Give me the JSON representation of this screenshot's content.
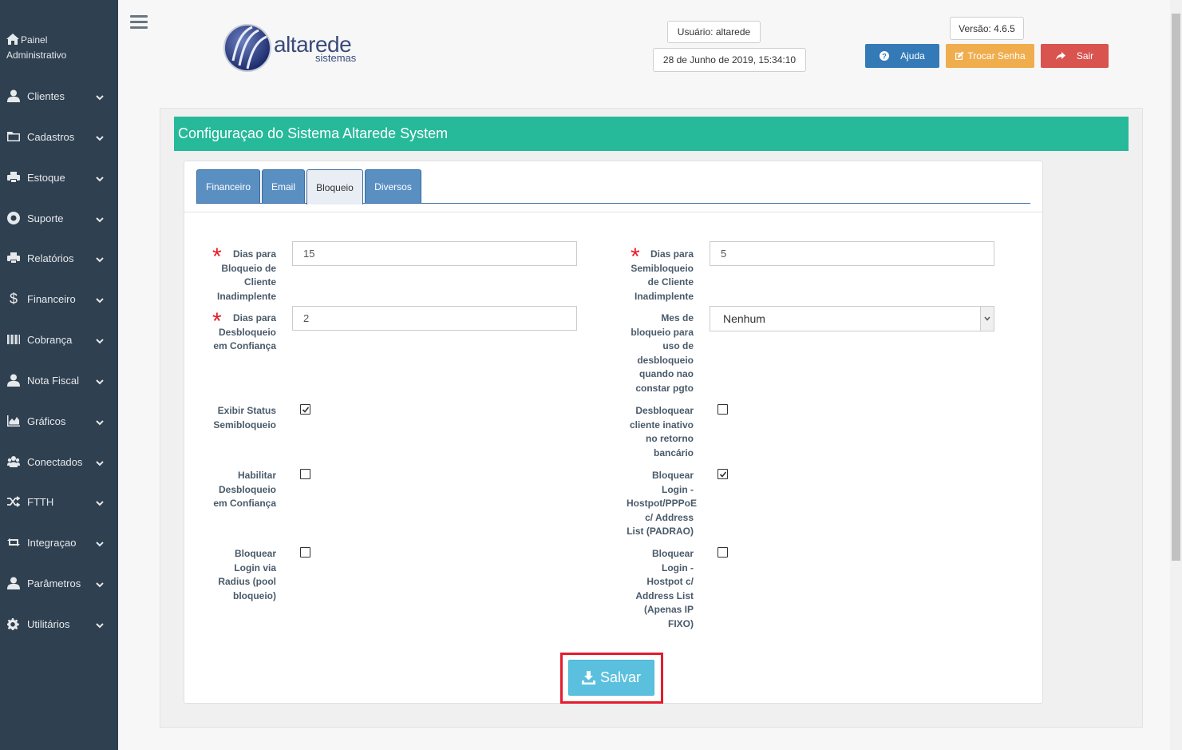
{
  "sidebar": {
    "panel_line1": "Painel",
    "panel_line2": "Administrativo",
    "items": [
      {
        "label": "Clientes",
        "icon": "user-icon"
      },
      {
        "label": "Cadastros",
        "icon": "folder-icon"
      },
      {
        "label": "Estoque",
        "icon": "printer-icon"
      },
      {
        "label": "Suporte",
        "icon": "lifebuoy-icon"
      },
      {
        "label": "Relatórios",
        "icon": "printer-icon"
      },
      {
        "label": "Financeiro",
        "icon": "dollar-icon"
      },
      {
        "label": "Cobrança",
        "icon": "barcode-icon"
      },
      {
        "label": "Nota Fiscal",
        "icon": "user-icon"
      },
      {
        "label": "Gráficos",
        "icon": "area-chart-icon"
      },
      {
        "label": "Conectados",
        "icon": "users-icon"
      },
      {
        "label": "FTTH",
        "icon": "shuffle-icon"
      },
      {
        "label": "Integraçao",
        "icon": "retweet-icon"
      },
      {
        "label": "Parâmetros",
        "icon": "user-icon"
      },
      {
        "label": "Utilitários",
        "icon": "cogs-icon"
      }
    ]
  },
  "header": {
    "logo_main": "altarede",
    "logo_sub": "sistemas",
    "user": "Usuário: altarede",
    "datetime": "28 de Junho de 2019, 15:34:10",
    "version": "Versão: 4.6.5",
    "help_label": "Ajuda",
    "change_password_label": "Trocar Senha",
    "exit_label": "Sair"
  },
  "page": {
    "title": "Configuraçao do Sistema Altarede System",
    "tabs": [
      "Financeiro",
      "Email",
      "Bloqueio",
      "Diversos"
    ],
    "active_tab": "Bloqueio"
  },
  "form": {
    "dias_bloqueio": {
      "label_lines": [
        "Dias para",
        "Bloqueio de",
        "Cliente",
        "Inadimplente"
      ],
      "value": "15"
    },
    "dias_semibloqueio": {
      "label_lines": [
        "Dias para",
        "Semibloqueio",
        "de Cliente",
        "Inadimplente"
      ],
      "value": "5"
    },
    "dias_desbloqueio": {
      "label_lines": [
        "Dias para",
        "Desbloqueio",
        "em Confiança"
      ],
      "value": "2"
    },
    "mes_bloqueio": {
      "label_lines": [
        "Mes de",
        "bloqueio para",
        "uso de",
        "desbloqueio",
        "quando nao",
        "constar pgto"
      ],
      "value": "Nenhum"
    },
    "exibir_status": {
      "label_lines": [
        "Exibir Status",
        "Semibloqueio"
      ],
      "checked": true
    },
    "desbloquear_inativo": {
      "label_lines": [
        "Desbloquear",
        "cliente inativo",
        "no retorno",
        "bancário"
      ],
      "checked": false
    },
    "habilitar_desbloqueio": {
      "label_lines": [
        "Habilitar",
        "Desbloqueio",
        "em Confiança"
      ],
      "checked": false
    },
    "bloquear_login_padrao": {
      "label_lines": [
        "Bloquear",
        "Login -",
        "Hostpot/PPPoE",
        "c/ Address",
        "List (PADRAO)"
      ],
      "checked": true
    },
    "bloquear_radius": {
      "label_lines": [
        "Bloquear",
        "Login via",
        "Radius (pool",
        "bloqueio)"
      ],
      "checked": false
    },
    "bloquear_login_ipfixo": {
      "label_lines": [
        "Bloquear",
        "Login -",
        "Hostpot c/",
        "Address List",
        "(Apenas IP",
        "FIXO)"
      ],
      "checked": false
    },
    "save_label": "Salvar"
  },
  "colors": {
    "sidebar_bg": "#2f4050",
    "title_bar": "#26b99a",
    "tab_inactive": "#5a8fc2",
    "help": "#337ab7",
    "change_password": "#f0ad4e",
    "exit": "#d9534f",
    "save": "#5bc0de",
    "highlight": "#e41c2c"
  }
}
